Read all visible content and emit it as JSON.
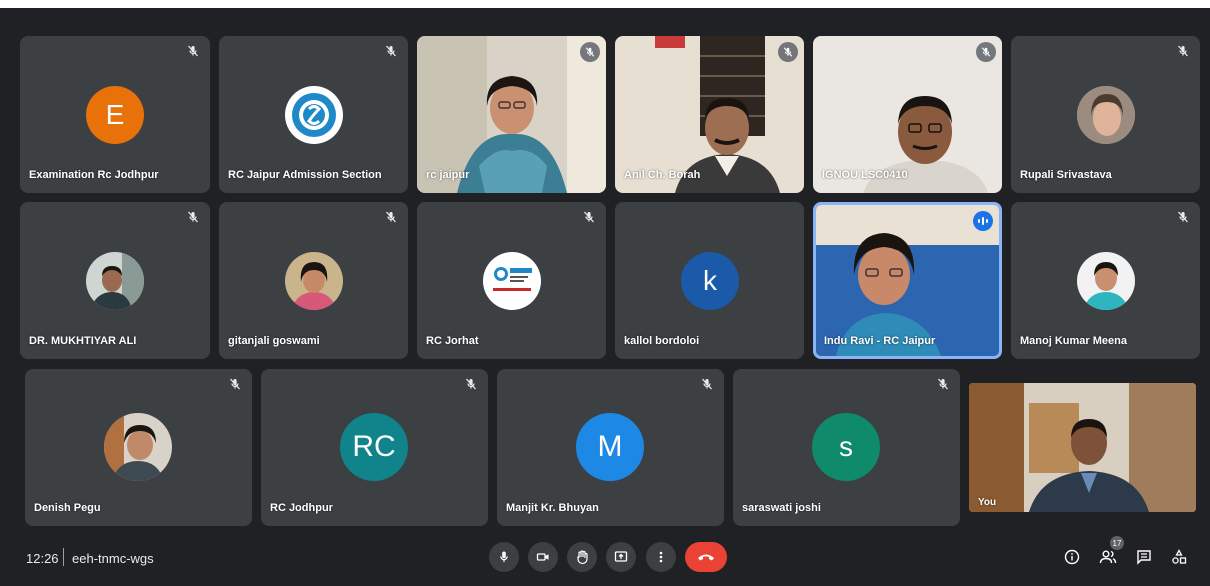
{
  "participants": [
    {
      "name": "Examination Rc Jodhpur",
      "initial": "E",
      "avatar_color": "#e8710a"
    },
    {
      "name": "RC Jaipur Admission Section",
      "avatar_logo": "ignou-logo"
    },
    {
      "name": "rc jaipur",
      "video": "camera-feed"
    },
    {
      "name": "Anil Ch. Borah",
      "video": "camera-feed"
    },
    {
      "name": "IGNOU LSC0410",
      "video": "camera-feed"
    },
    {
      "name": "Rupali Srivastava",
      "avatar_photo": "profile-photo"
    },
    {
      "name": "DR. MUKHTIYAR ALI",
      "avatar_photo": "profile-photo"
    },
    {
      "name": "gitanjali goswami",
      "avatar_photo": "profile-photo"
    },
    {
      "name": "RC Jorhat",
      "avatar_logo": "ignou-regional-logo"
    },
    {
      "name": "kallol bordoloi",
      "initial": "k",
      "avatar_color": "#1a5aa8"
    },
    {
      "name": "Indu Ravi - RC Jaipur",
      "video": "camera-feed",
      "speaking": true
    },
    {
      "name": "Manoj Kumar Meena",
      "avatar_photo": "profile-photo"
    },
    {
      "name": "Denish Pegu",
      "avatar_photo": "profile-photo"
    },
    {
      "name": "RC Jodhpur",
      "initial": "RC",
      "avatar_color": "#11838b"
    },
    {
      "name": "Manjit Kr. Bhuyan",
      "initial": "M",
      "avatar_color": "#1e88e5"
    },
    {
      "name": "saraswati joshi",
      "initial": "s",
      "avatar_color": "#0f8a6b"
    },
    {
      "name": "You",
      "video": "camera-feed"
    }
  ],
  "meeting": {
    "time": "12:26",
    "code": "eeh-tnmc-wgs",
    "participant_count": "17"
  },
  "controls": {
    "icons": [
      "microphone-icon",
      "camera-icon",
      "raise-hand-icon",
      "present-screen-icon",
      "more-options-icon",
      "end-call-icon"
    ],
    "right_icons": [
      "info-icon",
      "people-icon",
      "chat-icon",
      "activities-icon"
    ]
  },
  "colors": {
    "background": "#202124",
    "tile": "#3c4043",
    "end_call": "#ea4335",
    "speaking_border": "#8ab4f8"
  }
}
